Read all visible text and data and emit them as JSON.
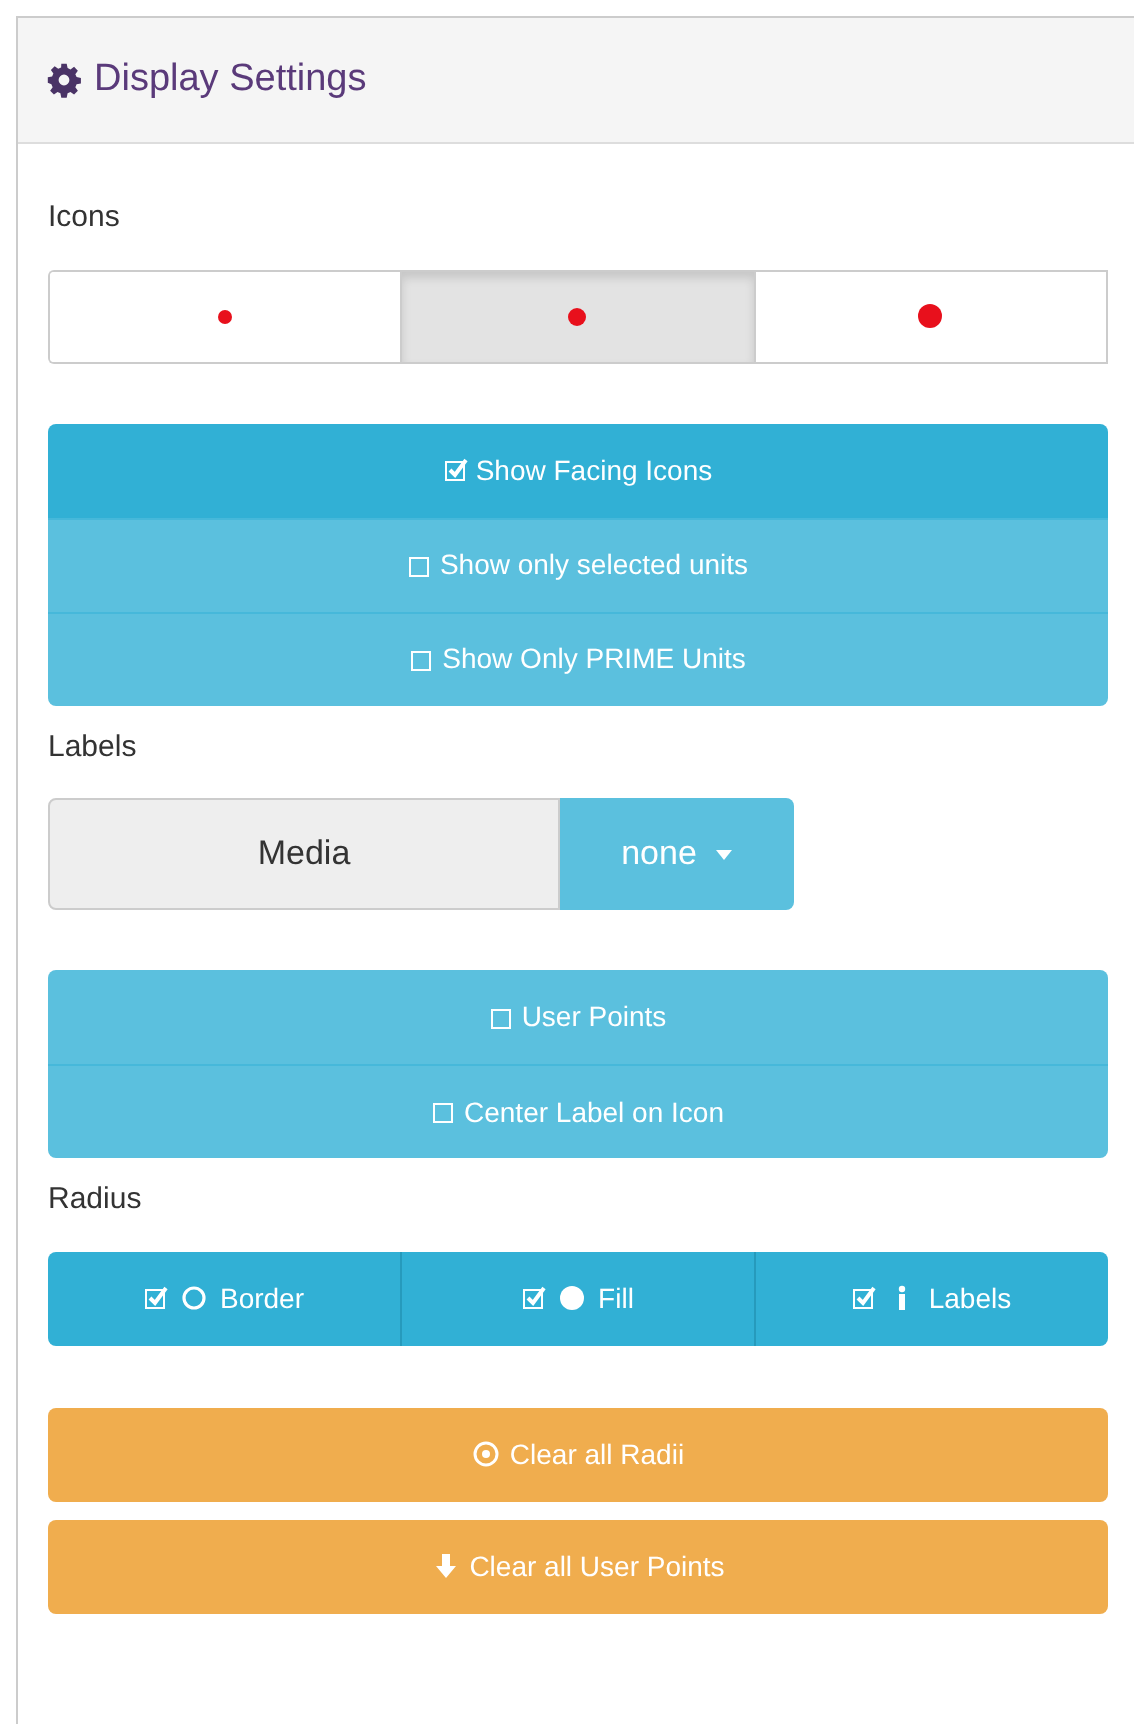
{
  "panel": {
    "title": "Display Settings"
  },
  "icons": {
    "label": "Icons",
    "sizes": [
      {
        "kind": "small",
        "selected": false
      },
      {
        "kind": "medium",
        "selected": true
      },
      {
        "kind": "large",
        "selected": false
      }
    ]
  },
  "toggles": [
    {
      "label": "Show Facing Icons",
      "checked": true
    },
    {
      "label": "Show only selected units",
      "checked": false
    },
    {
      "label": "Show Only PRIME Units",
      "checked": false
    }
  ],
  "labels": {
    "label": "Labels",
    "field": "Media",
    "dropdown": "none",
    "toggles": [
      {
        "label": "User Points",
        "checked": false
      },
      {
        "label": "Center Label on Icon",
        "checked": false
      }
    ]
  },
  "radius": {
    "label": "Radius",
    "toggles": [
      {
        "label": "Border",
        "kind": "ring",
        "checked": true
      },
      {
        "label": "Fill",
        "kind": "dot",
        "checked": true
      },
      {
        "label": "Labels",
        "kind": "info",
        "checked": true
      }
    ]
  },
  "actions": [
    {
      "label": "Clear all Radii",
      "kind": "target"
    },
    {
      "label": "Clear all User Points",
      "kind": "down"
    }
  ]
}
